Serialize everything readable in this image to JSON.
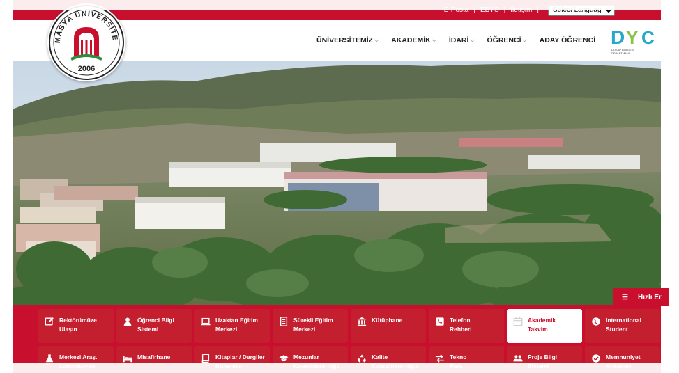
{
  "topbar": {
    "links": [
      "E-Posta",
      "EBYS",
      "İletişim"
    ],
    "language_select": "Select Language"
  },
  "logo": {
    "name": "AMASYA ÜNİVERSİTESİ",
    "year": "2006"
  },
  "nav": {
    "items": [
      "ÜNİVERSİTEMİZ",
      "AKADEMİK",
      "İDARİ",
      "ÖĞRENCİ",
      "ADAY ÖĞRENCİ"
    ]
  },
  "dyc_logo": {
    "letters": "DYC",
    "caption": "DOKAP BÖLGESİ\nDEPARTMANI"
  },
  "quick_access": {
    "label": "Hızlı Er"
  },
  "tiles": [
    {
      "label": "Rektörümüze\nUlaşın",
      "icon": "edit-icon"
    },
    {
      "label": "Öğrenci Bilgi\nSistemi",
      "icon": "user-icon"
    },
    {
      "label": "Uzaktan Eğitim\nMerkezi",
      "icon": "laptop-icon"
    },
    {
      "label": "Sürekli Eğitim\nMerkezi",
      "icon": "document-icon"
    },
    {
      "label": "Kütüphane",
      "icon": "library-icon"
    },
    {
      "label": "Telefon\nRehberi",
      "icon": "phone-icon"
    },
    {
      "label": "Akademik\nTakvim",
      "icon": "calendar-icon",
      "active": true
    },
    {
      "label": "International\nStudent",
      "icon": "globe-icon"
    },
    {
      "label": "Merkezi Araş.\nLaboratuvarı",
      "icon": "flask-icon"
    },
    {
      "label": "Misafirhane",
      "icon": "bed-icon"
    },
    {
      "label": "Kitaplar / Dergiler\nBültenler",
      "icon": "book-icon"
    },
    {
      "label": "Mezunlar\nKoordinatörlüğü",
      "icon": "graduation-cap-icon"
    },
    {
      "label": "Kalite\nKoordinatörlüğü",
      "icon": "recycle-icon"
    },
    {
      "label": "Tekno\nPark",
      "icon": "exchange-icon"
    },
    {
      "label": "Proje Bilgi\nSistemi",
      "icon": "users-icon"
    },
    {
      "label": "Memnuniyet\nAnketleri",
      "icon": "check-circle-icon"
    }
  ],
  "colors": {
    "brand_red": "#c8102e",
    "tile_red": "#c31f2f",
    "active_tile": "#ffffff"
  }
}
